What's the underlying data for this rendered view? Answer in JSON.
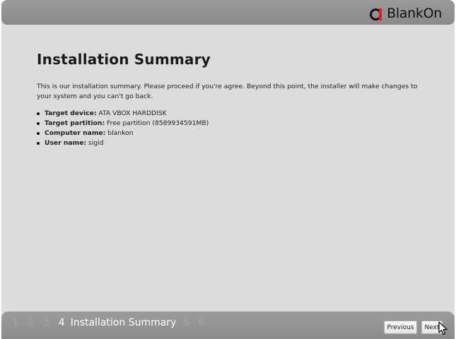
{
  "brand": {
    "text": "BlankOn",
    "mark_ring_color": "#111111",
    "mark_bar_color": "#e02020"
  },
  "main": {
    "title": "Installation Summary",
    "intro": "This is our installation summary. Please proceed if you're agree. Beyond this point, the installer will make changes to your system and you can't go back.",
    "items": [
      {
        "key": "Target device:",
        "value": " ATA VBOX HARDDISK"
      },
      {
        "key": "Target partition:",
        "value": " Free partition (8589934591MB)"
      },
      {
        "key": "Computer name:",
        "value": " blankon"
      },
      {
        "key": "User name:",
        "value": " sigid"
      }
    ]
  },
  "footer": {
    "steps": [
      "1",
      "2",
      "3",
      "4",
      "5",
      "6"
    ],
    "active_step": "4",
    "active_label": "Installation Summary",
    "previous_label": "Previous",
    "next_label": "Next"
  }
}
